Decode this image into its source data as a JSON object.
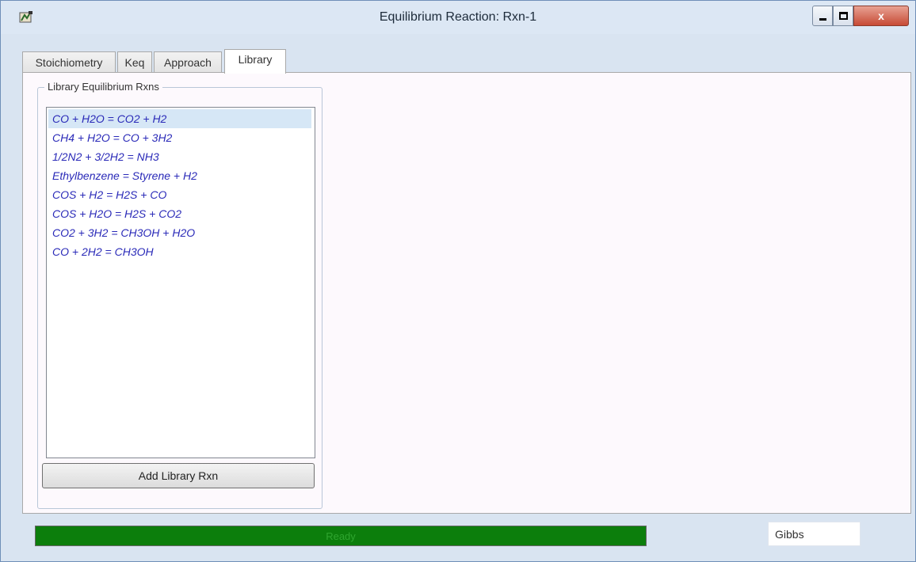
{
  "window": {
    "title": "Equilibrium Reaction: Rxn-1",
    "icon": "app-icon",
    "controls": {
      "minimize": "minimize",
      "maximize": "maximize",
      "close": "x"
    }
  },
  "tabs": [
    {
      "label": "Stoichiometry",
      "active": false
    },
    {
      "label": "Keq",
      "active": false
    },
    {
      "label": "Approach",
      "active": false
    },
    {
      "label": "Library",
      "active": true
    }
  ],
  "library": {
    "group_label": "Library Equilibrium Rxns",
    "reactions": [
      "CO + H2O = CO2 + H2",
      "CH4 + H2O = CO + 3H2",
      "1/2N2 + 3/2H2 = NH3",
      "Ethylbenzene = Styrene + H2",
      "COS + H2 = H2S + CO",
      "COS + H2O = H2S + CO2",
      "CO2 + 3H2 = CH3OH + H2O",
      "CO + 2H2 = CH3OH"
    ],
    "selected_index": 0,
    "add_button_label": "Add Library Rxn"
  },
  "status": {
    "progress_text": "Ready",
    "progress_fraction": 1.0,
    "method_value": "Gibbs"
  },
  "colors": {
    "progress": "#0c7e0c",
    "list_text": "#2a2ab8",
    "selection": "#d6e7f6"
  }
}
